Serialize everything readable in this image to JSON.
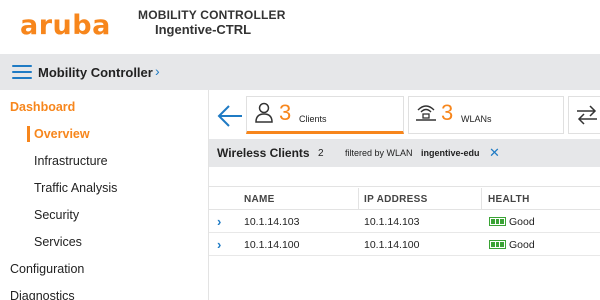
{
  "header": {
    "logo": "aruba",
    "title": "MOBILITY CONTROLLER",
    "controller_name": "Ingentive-CTRL"
  },
  "navbar": {
    "title": "Mobility Controller",
    "chevron": "›"
  },
  "sidebar": {
    "items": [
      {
        "label": "Dashboard",
        "active": true
      },
      {
        "label": "Overview",
        "active": true
      },
      {
        "label": "Infrastructure"
      },
      {
        "label": "Traffic Analysis"
      },
      {
        "label": "Security"
      },
      {
        "label": "Services"
      },
      {
        "label": "Configuration"
      },
      {
        "label": "Diagnostics"
      }
    ]
  },
  "tabs": [
    {
      "count": "3",
      "label": "Clients",
      "icon": "user-icon",
      "selected": true
    },
    {
      "count": "3",
      "label": "WLANs",
      "icon": "wifi-ap-icon"
    },
    {
      "icon": "swap-arrows-icon"
    }
  ],
  "section": {
    "title": "Wireless Clients",
    "count": "2",
    "filter_label": "filtered by WLAN",
    "filter_value": "ingentive-edu",
    "close_glyph": "✕"
  },
  "table": {
    "columns": [
      "NAME",
      "IP ADDRESS",
      "HEALTH"
    ],
    "rows": [
      {
        "name": "10.1.14.103",
        "ip": "10.1.14.103",
        "health": "Good"
      },
      {
        "name": "10.1.14.100",
        "ip": "10.1.14.100",
        "health": "Good"
      }
    ],
    "expand_glyph": "›"
  },
  "colors": {
    "brand": "#f7861c",
    "accent": "#1f7bc4",
    "health_good": "#3aa335"
  }
}
